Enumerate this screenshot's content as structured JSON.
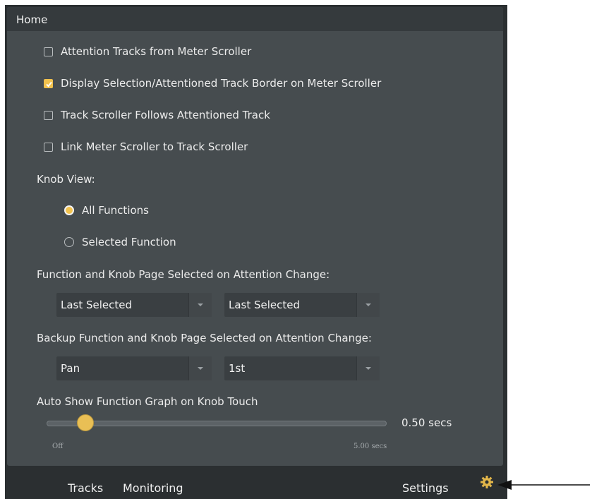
{
  "header": {
    "title": "Home"
  },
  "checkboxes": [
    {
      "label": "Attention Tracks from Meter Scroller",
      "checked": false
    },
    {
      "label": "Display Selection/Attentioned Track Border on Meter Scroller",
      "checked": true
    },
    {
      "label": "Track Scroller Follows Attentioned Track",
      "checked": false
    },
    {
      "label": "Link Meter Scroller to Track Scroller",
      "checked": false
    }
  ],
  "knob_view": {
    "label": "Knob View:",
    "options": [
      {
        "label": "All Functions",
        "selected": true
      },
      {
        "label": "Selected Function",
        "selected": false
      }
    ]
  },
  "function_page": {
    "label": "Function and Knob Page Selected on Attention Change:",
    "dropdown1": "Last Selected",
    "dropdown2": "Last Selected"
  },
  "backup_page": {
    "label": "Backup Function and Knob Page Selected on Attention Change:",
    "dropdown1": "Pan",
    "dropdown2": "1st"
  },
  "auto_show": {
    "label": "Auto Show Function Graph on Knob Touch",
    "value_text": "0.50 secs",
    "value_fraction": 0.1,
    "min_label": "Off",
    "max_label": "5.00 secs"
  },
  "tabs": {
    "tracks": "Tracks",
    "monitoring": "Monitoring",
    "settings": "Settings"
  },
  "colors": {
    "accent": "#f2c24e",
    "panel": "#464c4f",
    "frame": "#2b2f31"
  },
  "icons": {
    "settings": "gear-icon",
    "annotation": "arrow-left-icon"
  }
}
